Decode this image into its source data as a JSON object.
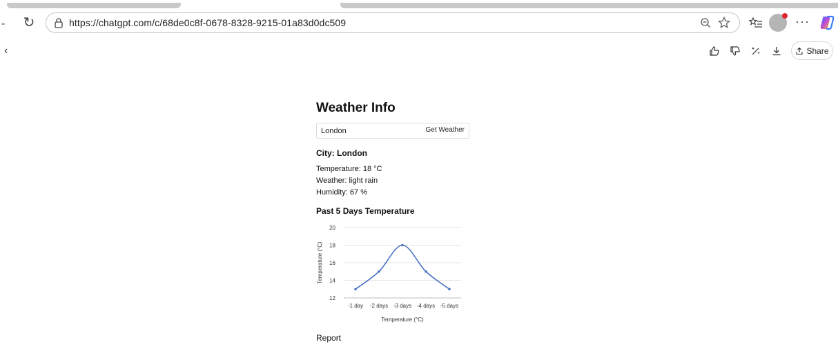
{
  "browser": {
    "url": "https://chatgpt.com/c/68de0c8f-0678-8328-9215-01a83d0dc509",
    "toolbar_more": "···"
  },
  "pagebar": {
    "share_label": "Share"
  },
  "app": {
    "title": "Weather Info",
    "search": {
      "value": "London",
      "button_label": "Get Weather"
    },
    "city_line": "City: London",
    "temperature_line": "Temperature: 18 °C",
    "weather_line": "Weather: light rain",
    "humidity_line": "Humidity: 67 %",
    "chart_heading": "Past 5 Days Temperature",
    "report_label": "Report"
  },
  "colors": {
    "line": "#4a72c4",
    "grid": "#e6e6e6",
    "axis": "#bdbdbd"
  },
  "chart_data": {
    "type": "line",
    "title": "",
    "xlabel": "Temperature (°C)",
    "ylabel": "Temperature (°C)",
    "categories": [
      "-1 day",
      "-2 days",
      "-3 days",
      "-4 days",
      "-5 days"
    ],
    "series": [
      {
        "values": [
          13,
          15,
          18,
          15,
          13
        ]
      }
    ],
    "ylim": [
      12,
      20
    ],
    "yticks": [
      12,
      14,
      16,
      18,
      20
    ],
    "grid": true,
    "legend": "none"
  }
}
